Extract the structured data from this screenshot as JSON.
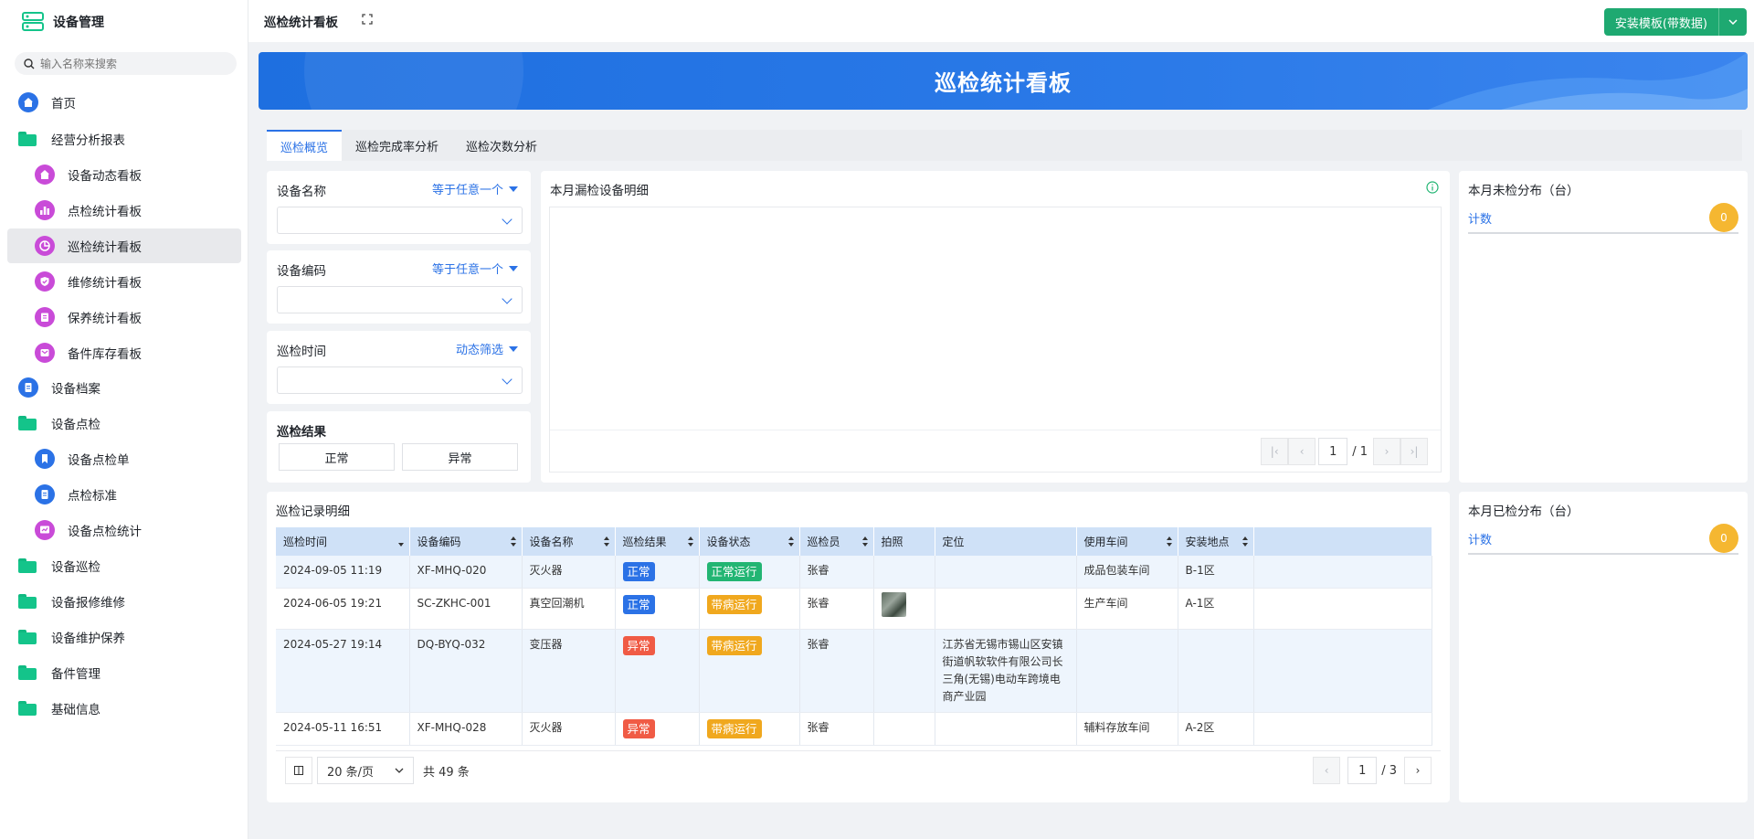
{
  "sidebar": {
    "brand": "设备管理",
    "search_placeholder": "输入名称来搜索",
    "items": [
      {
        "label": "首页",
        "icon": "home-icon"
      },
      {
        "label": "经营分析报表",
        "icon": "folder-icon"
      },
      {
        "label": "设备动态看板",
        "icon": "home-icon"
      },
      {
        "label": "点检统计看板",
        "icon": "bar-chart-icon"
      },
      {
        "label": "巡检统计看板",
        "icon": "pie-chart-icon"
      },
      {
        "label": "维修统计看板",
        "icon": "shield-check-icon"
      },
      {
        "label": "保养统计看板",
        "icon": "clipboard-icon"
      },
      {
        "label": "备件库存看板",
        "icon": "inbox-icon"
      },
      {
        "label": "设备档案",
        "icon": "document-icon"
      },
      {
        "label": "设备点检",
        "icon": "folder-icon"
      },
      {
        "label": "设备点检单",
        "icon": "bookmark-icon"
      },
      {
        "label": "点检标准",
        "icon": "document-icon"
      },
      {
        "label": "设备点检统计",
        "icon": "stats-icon"
      },
      {
        "label": "设备巡检",
        "icon": "folder-icon"
      },
      {
        "label": "设备报修维修",
        "icon": "folder-icon"
      },
      {
        "label": "设备维护保养",
        "icon": "folder-icon"
      },
      {
        "label": "备件管理",
        "icon": "folder-icon"
      },
      {
        "label": "基础信息",
        "icon": "folder-icon"
      }
    ]
  },
  "header": {
    "title": "巡检统计看板",
    "install_label": "安装模板(带数据)"
  },
  "banner": {
    "title": "巡检统计看板"
  },
  "tabs": [
    "巡检概览",
    "巡检完成率分析",
    "巡检次数分析"
  ],
  "filters": {
    "device_name": {
      "label": "设备名称",
      "op": "等于任意一个"
    },
    "device_code": {
      "label": "设备编码",
      "op": "等于任意一个"
    },
    "inspect_time": {
      "label": "巡检时间",
      "op": "动态筛选"
    },
    "result": {
      "label": "巡检结果",
      "options": [
        "正常",
        "异常"
      ]
    }
  },
  "missed": {
    "title": "本月漏检设备明细",
    "page": "1",
    "total_pages": "/ 1"
  },
  "unchecked_dist": {
    "title": "本月未检分布（台）",
    "key": "计数",
    "value": "0"
  },
  "checked_dist": {
    "title": "本月已检分布（台）",
    "key": "计数",
    "value": "0"
  },
  "records": {
    "title": "巡检记录明细",
    "columns": [
      "巡检时间",
      "设备编码",
      "设备名称",
      "巡检结果",
      "设备状态",
      "巡检员",
      "拍照",
      "定位",
      "使用车间",
      "安装地点"
    ],
    "rows": [
      {
        "time": "2024-09-05 11:19",
        "code": "XF-MHQ-020",
        "name": "灭火器",
        "result": "正常",
        "status": "正常运行",
        "inspector": "张睿",
        "photo": false,
        "location": "",
        "workshop": "成品包装车间",
        "place": "B-1区"
      },
      {
        "time": "2024-06-05 19:21",
        "code": "SC-ZKHC-001",
        "name": "真空回潮机",
        "result": "正常",
        "status": "带病运行",
        "inspector": "张睿",
        "photo": true,
        "location": "",
        "workshop": "生产车间",
        "place": "A-1区"
      },
      {
        "time": "2024-05-27 19:14",
        "code": "DQ-BYQ-032",
        "name": "变压器",
        "result": "异常",
        "status": "带病运行",
        "inspector": "张睿",
        "photo": false,
        "location": "江苏省无锡市锡山区安镇街道帆软软件有限公司长三角(无锡)电动车跨境电商产业园",
        "workshop": "",
        "place": ""
      },
      {
        "time": "2024-05-11 16:51",
        "code": "XF-MHQ-028",
        "name": "灭火器",
        "result": "异常",
        "status": "带病运行",
        "inspector": "张睿",
        "photo": false,
        "location": "",
        "workshop": "辅料存放车间",
        "place": "A-2区"
      }
    ],
    "page_size": "20 条/页",
    "total": "共 49 条",
    "page": "1",
    "total_pages": "/ 3"
  },
  "colors": {
    "accent": "#2b72e6",
    "install": "#1ea971",
    "normal": "#2b72e6",
    "abnormal": "#f05b45",
    "running": "#22b573",
    "sick": "#f0a81e"
  }
}
